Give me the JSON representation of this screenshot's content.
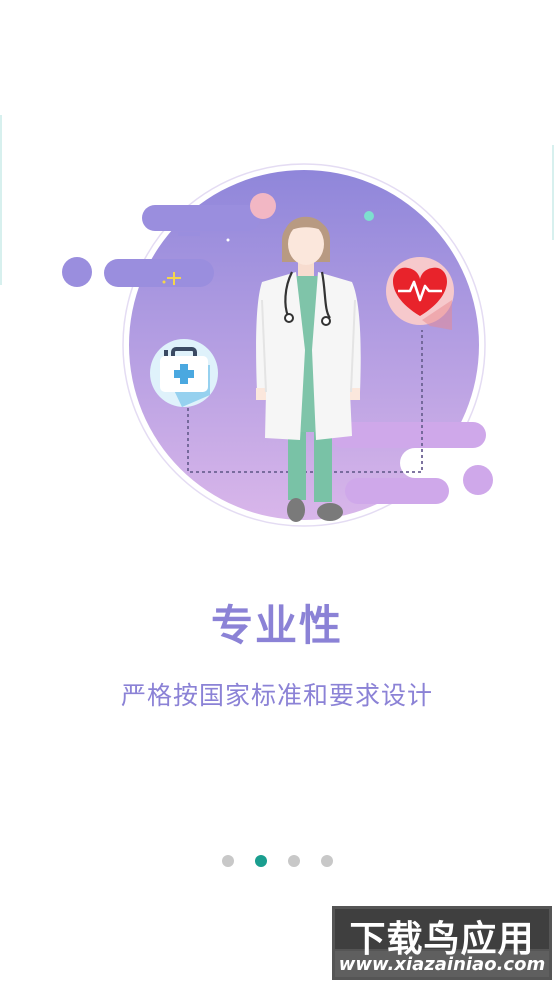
{
  "onboarding": {
    "title": "专业性",
    "subtitle": "严格按国家标准和要求设计",
    "page_count": 4,
    "active_page_index": 1
  },
  "watermark": {
    "brand": "下载鸟应用",
    "url": "www.xiazainiao.com"
  },
  "colors": {
    "accent_purple": "#8b82d6",
    "active_dot": "#1a9e8f",
    "inactive_dot": "#c8c8c8",
    "heart_red": "#e8232b",
    "medkit_blue": "#4aa8e0"
  },
  "icons": [
    "doctor-illustration",
    "heartbeat-icon",
    "medical-kit-icon"
  ]
}
